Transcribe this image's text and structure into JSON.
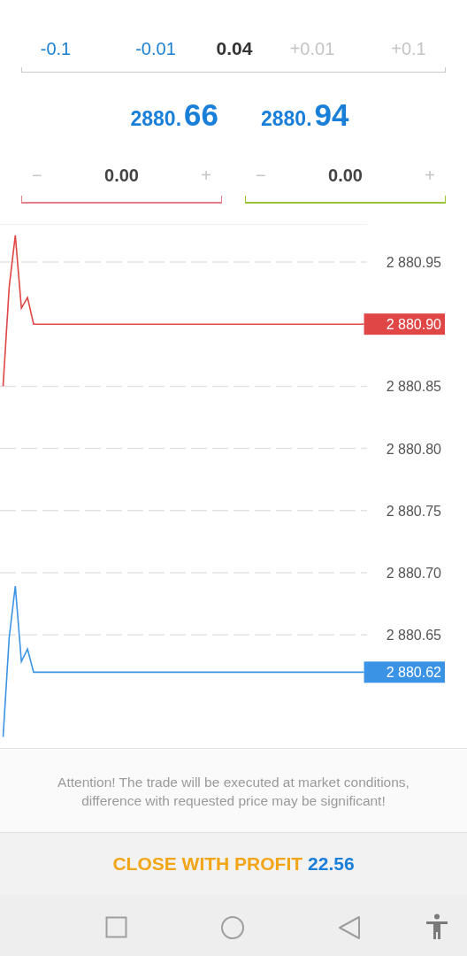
{
  "volume_selector": [
    {
      "label": "-0.1",
      "kind": "step",
      "disabled": false
    },
    {
      "label": "-0.01",
      "kind": "step",
      "disabled": false
    },
    {
      "label": "0.04",
      "kind": "value"
    },
    {
      "label": "+0.01",
      "kind": "step",
      "disabled": true
    },
    {
      "label": "+0.1",
      "kind": "step",
      "disabled": true
    }
  ],
  "quotes": [
    {
      "base": "2880.",
      "pips": "66"
    },
    {
      "base": "2880.",
      "pips": "94"
    }
  ],
  "stop_fields": [
    {
      "minus": "−",
      "value": "0.00",
      "plus": "+",
      "color": "#e57f8c"
    },
    {
      "minus": "−",
      "value": "0.00",
      "plus": "+",
      "color": "#9cc43a"
    }
  ],
  "chart": {
    "chart_data": {
      "type": "line",
      "grid": true,
      "ylim": [
        2880.5583,
        2880.9806
      ],
      "yticks": [
        {
          "value": 2880.95,
          "label": "2 880.95"
        },
        {
          "value": 2880.85,
          "label": "2 880.85"
        },
        {
          "value": 2880.8,
          "label": "2 880.80"
        },
        {
          "value": 2880.75,
          "label": "2 880.75"
        },
        {
          "value": 2880.7,
          "label": "2 880.70"
        },
        {
          "value": 2880.65,
          "label": "2 880.65"
        }
      ],
      "categories": [
        null,
        null,
        null,
        null,
        null,
        null,
        null,
        null,
        null,
        null,
        null,
        null,
        null,
        null,
        null,
        null,
        null,
        null,
        null,
        null,
        null,
        null,
        null,
        null,
        null,
        null,
        null,
        null,
        null,
        null,
        null,
        null,
        null,
        null,
        null,
        null,
        null,
        null,
        null,
        null,
        null,
        null,
        null,
        null,
        null,
        null,
        null,
        null,
        null,
        null,
        null,
        null,
        null,
        null,
        null,
        null,
        null,
        null,
        null,
        null
      ],
      "series": [
        {
          "color": "#e04646",
          "values": [
            2880.85,
            2880.93,
            2880.9714,
            2880.9129,
            2880.9214,
            2880.9,
            2880.9,
            2880.9,
            2880.9,
            2880.9,
            2880.9,
            2880.9,
            2880.9,
            2880.9,
            2880.9,
            2880.9,
            2880.9,
            2880.9,
            2880.9,
            2880.9,
            2880.9,
            2880.9,
            2880.9,
            2880.9,
            2880.9,
            2880.9,
            2880.9,
            2880.9,
            2880.9,
            2880.9,
            2880.9,
            2880.9,
            2880.9,
            2880.9,
            2880.9,
            2880.9,
            2880.9,
            2880.9,
            2880.9,
            2880.9,
            2880.9,
            2880.9,
            2880.9,
            2880.9,
            2880.9,
            2880.9,
            2880.9,
            2880.9,
            2880.9,
            2880.9,
            2880.9,
            2880.9,
            2880.9,
            2880.9,
            2880.9,
            2880.9,
            2880.9,
            2880.9,
            2880.9,
            2880.9
          ]
        },
        {
          "color": "#3a93e4",
          "values": [
            2880.5679,
            2880.6479,
            2880.6893,
            2880.6286,
            2880.6386,
            2880.62,
            2880.62,
            2880.62,
            2880.62,
            2880.62,
            2880.62,
            2880.62,
            2880.62,
            2880.62,
            2880.62,
            2880.62,
            2880.62,
            2880.62,
            2880.62,
            2880.62,
            2880.62,
            2880.62,
            2880.62,
            2880.62,
            2880.62,
            2880.62,
            2880.62,
            2880.62,
            2880.62,
            2880.62,
            2880.62,
            2880.62,
            2880.62,
            2880.62,
            2880.62,
            2880.62,
            2880.62,
            2880.62,
            2880.62,
            2880.62,
            2880.62,
            2880.62,
            2880.62,
            2880.62,
            2880.62,
            2880.62,
            2880.62,
            2880.62,
            2880.62,
            2880.62,
            2880.62,
            2880.62,
            2880.62,
            2880.62,
            2880.62,
            2880.62,
            2880.62,
            2880.62,
            2880.62,
            2880.62
          ]
        }
      ]
    },
    "price_tags": [
      {
        "text": "2 880.90",
        "color": "#e04646"
      },
      {
        "text": "2 880.62",
        "color": "#3a93e4"
      }
    ]
  },
  "notice": "Attention! The trade will be executed at market conditions, difference with requested price may be significant!",
  "close_button": {
    "label": "CLOSE WITH PROFIT",
    "amount": "22.56"
  }
}
